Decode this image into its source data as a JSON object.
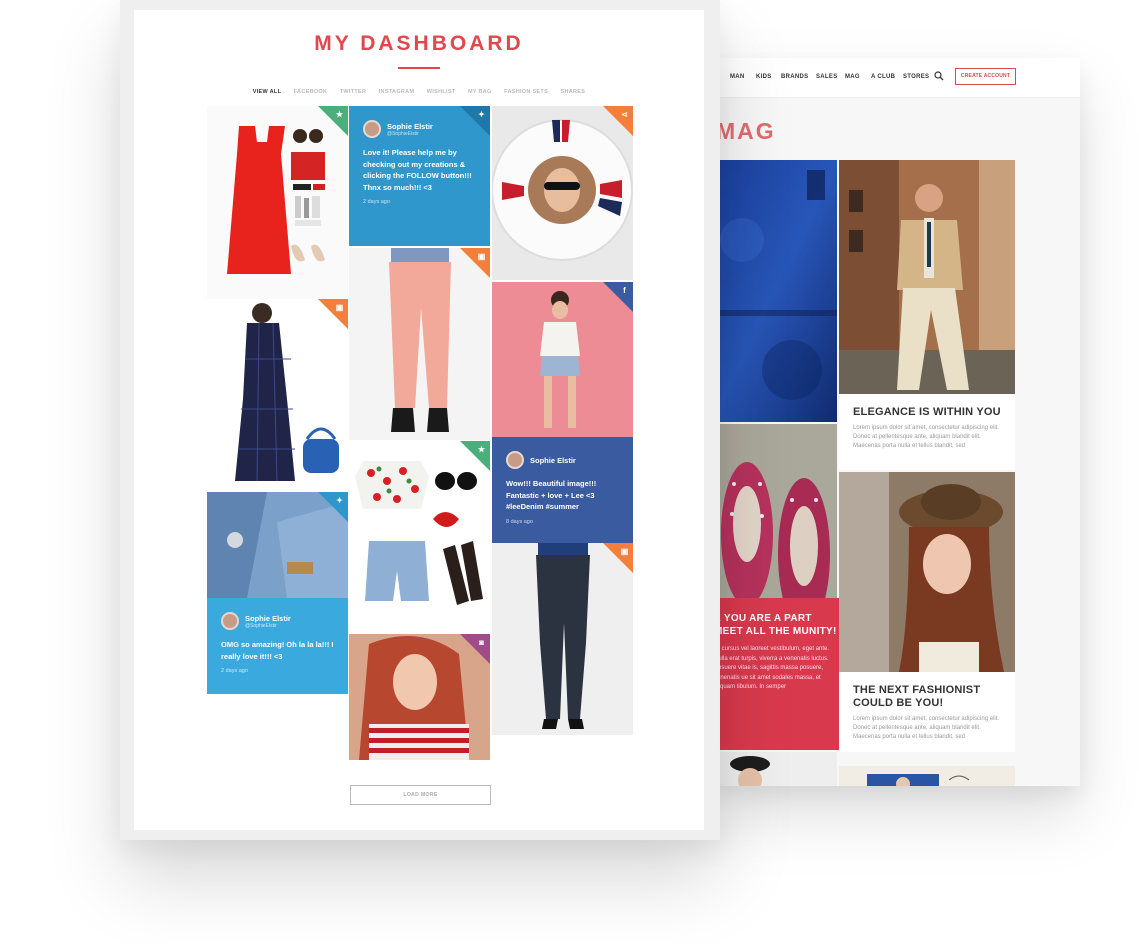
{
  "mag": {
    "nav": [
      {
        "label": "MAN"
      },
      {
        "label": "KIDS"
      },
      {
        "label": "BRANDS"
      },
      {
        "label": "SALES"
      },
      {
        "label": "MAG"
      },
      {
        "label": "A CLUB"
      },
      {
        "label": "STORES"
      }
    ],
    "create_account": "CREATE ACCOUNT",
    "title": "MAG",
    "article1": {
      "title": "ELEGANCE IS WITHIN YOU",
      "body": "Lorem ipsum dolor sit amet, consectetur adipiscing elit. Donec at pellentesque ante, aliquam blandit elit. Maecenas porta nulla et tellus blandit, sed"
    },
    "article2": {
      "title": "THE NEXT FASHIONIST COULD BE YOU!",
      "body": "Lorem ipsum dolor sit amet, consectetur adipiscing elit. Donec at pellentesque ante, aliquam blandit elit. Maecenas porta nulla et tellus blandit, sed"
    },
    "pink_title": "E YOU ARE A PART MEET ALL THE MUNITY!",
    "pink_body": "lit, cursus vel laoreet vestibulum, eget ante. Nulla erat turpis, viverra a venenatis luctus. Posuere vitae is, sagittis massa posuere, venenatis ue sit amet sodales massa, et aliquam tibulum. In semper"
  },
  "dashboard": {
    "title": "MY DASHBOARD",
    "tabs": [
      {
        "label": "VIEW ALL",
        "active": true
      },
      {
        "label": "FACEBOOK",
        "active": false
      },
      {
        "label": "TWITTER",
        "active": false
      },
      {
        "label": "INSTAGRAM",
        "active": false
      },
      {
        "label": "WISHLIST",
        "active": false
      },
      {
        "label": "MY BAG",
        "active": false
      },
      {
        "label": "FASHION SETS",
        "active": false
      },
      {
        "label": "SHARES",
        "active": false
      }
    ],
    "tweet1": {
      "name": "Sophie Elstir",
      "handle": "@SophieElstir",
      "text": "Love it! Please help me by checking out my creations & clicking the FOLLOW button!!! Thnx so much!!! <3",
      "time": "2 days ago"
    },
    "fb_post": {
      "name": "Sophie Elstir",
      "text": "Wow!!! Beautiful image!!! Fantastic + love + Lee <3 #leeDenim #summer",
      "time": "8 days ago"
    },
    "tweet2": {
      "name": "Sophie Elstir",
      "handle": "@SophieElstir",
      "text": "OMG so amazing! Oh la la la!!! I really love it!!! <3",
      "time": "2 days ago"
    },
    "load_more": "LOAD MORE",
    "colors": {
      "accent": "#e0484e",
      "green": "#4cae7a",
      "twitter": "#2f97cb",
      "orange": "#f47f3a",
      "facebook": "#3a5ba0",
      "instagram": "#a04b8a",
      "sky": "#3aa9de"
    }
  }
}
